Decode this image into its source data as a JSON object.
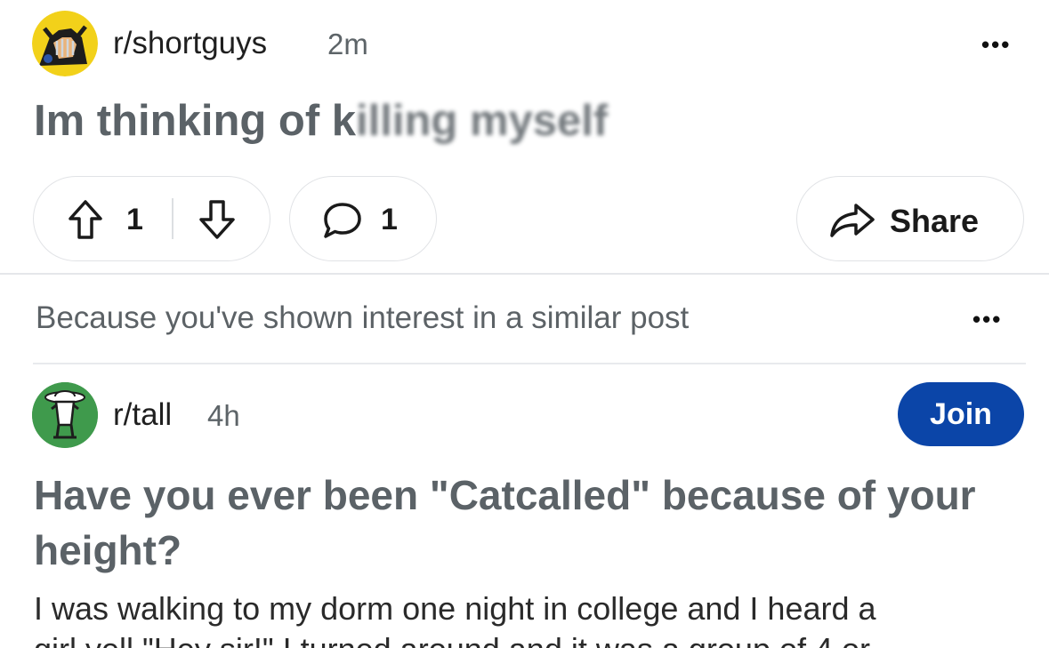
{
  "post1": {
    "subreddit": "r/shortguys",
    "time": "2m",
    "title_start": "Im thinking of k",
    "title_obscured": "illing myself",
    "upvotes": "1",
    "comments": "1",
    "share_label": "Share",
    "more_label": "•••"
  },
  "recommendation": {
    "reason": "Because you've shown interest in a similar post",
    "more_label": "•••"
  },
  "post2": {
    "subreddit": "r/tall",
    "time": "4h",
    "join_label": "Join",
    "title": "Have you ever been \"Catcalled\" because of your height?",
    "body_line1": "I was walking to my dorm one night in college and I heard a",
    "body_line2": "girl yell \"Hey sir!\" I turned around and it was a group of 4 or"
  },
  "colors": {
    "join_button": "#0b45a8",
    "title_gray": "#5b6267",
    "divider": "#e5e7ea",
    "avatar2_bg": "#3f9a4c",
    "avatar1_bg": "#f2d11a"
  },
  "icons": [
    "upvote-icon",
    "downvote-icon",
    "comment-icon",
    "share-icon",
    "more-options-icon",
    "subreddit-avatar-icon"
  ]
}
